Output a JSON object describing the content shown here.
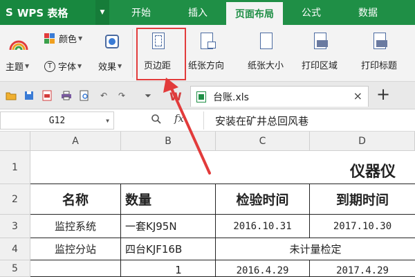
{
  "app": {
    "logo": "S",
    "name": "WPS 表格",
    "caret": "▼"
  },
  "tabs": [
    {
      "label": "开始",
      "active": false
    },
    {
      "label": "插入",
      "active": false
    },
    {
      "label": "页面布局",
      "active": true
    },
    {
      "label": "公式",
      "active": false
    },
    {
      "label": "数据",
      "active": false
    }
  ],
  "ribbon": {
    "color_label": "颜色",
    "theme_label": "主题",
    "font_label": "字体",
    "effect_label": "效果",
    "margins_label": "页边距",
    "orientation_label": "纸张方向",
    "size_label": "纸张大小",
    "print_area_label": "打印区域",
    "print_titles_label": "打印标题"
  },
  "document": {
    "tab_label": "台账.xls",
    "close": "×",
    "new_tab": "+"
  },
  "formula_bar": {
    "cell_ref": "G12",
    "fx": "fx",
    "content": "安装在矿井总回风巷"
  },
  "columns": [
    "A",
    "B",
    "C",
    "D"
  ],
  "rows": [
    "1",
    "2",
    "3",
    "4",
    "5"
  ],
  "sheet": {
    "title": "仪器仪",
    "headers": [
      "名称",
      "数量",
      "检验时间",
      "到期时间"
    ],
    "row3": [
      "监控系统",
      "一套KJ95N",
      "2016.10.31",
      "2017.10.30"
    ],
    "row4": [
      "监控分站",
      "四台KJF16B",
      "未计量检定"
    ],
    "row5": [
      "",
      "1",
      "2016.4.29",
      "2017.4.29"
    ]
  },
  "colors": {
    "accent": "#1f8f46",
    "highlight": "#e23b3b"
  }
}
